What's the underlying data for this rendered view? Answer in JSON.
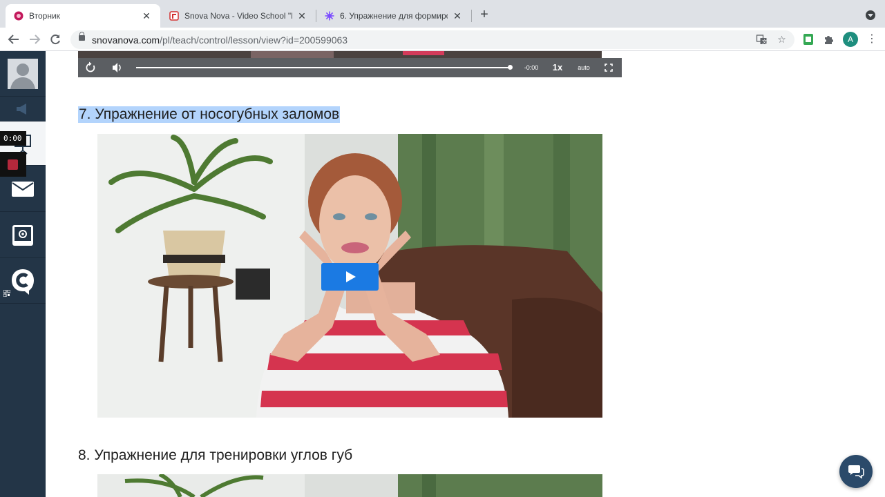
{
  "browser": {
    "tabs": [
      {
        "title": "Вторник",
        "active": true,
        "favicon_color": "#c2185b"
      },
      {
        "title": "Snova Nova - Video School \"El",
        "active": false,
        "favicon_color": "#d32f2f"
      },
      {
        "title": "6. Упражнение для формиров",
        "active": false,
        "favicon_color": "#7c4dff"
      }
    ],
    "new_tab_label": "+",
    "url_host": "snovanova.com",
    "url_path": "/pl/teach/control/lesson/view?id=200599063",
    "profile_initial": "A"
  },
  "sidebar": {
    "items": [
      {
        "name": "profile",
        "icon": "user-avatar-icon"
      },
      {
        "name": "announcements",
        "icon": "megaphone-icon"
      },
      {
        "name": "active-lesson",
        "icon": "presentation-icon"
      },
      {
        "name": "messages",
        "icon": "mail-icon"
      },
      {
        "name": "settings",
        "icon": "gear-monitor-icon"
      },
      {
        "name": "brand",
        "icon": "c-logo-icon"
      }
    ],
    "recorder_time": "0:00"
  },
  "player": {
    "time_remaining": "-0:00",
    "speed": "1x",
    "quality": "auto",
    "progress": 1.0
  },
  "sections": [
    {
      "heading": "7. Упражнение от носогубных заломов",
      "selected": true
    },
    {
      "heading": "8. Упражнение для тренировки углов губ",
      "selected": false
    }
  ],
  "colors": {
    "sidebar_bg": "#233547",
    "play_button": "#1b7ae3",
    "selection": "#b3d4fc",
    "chat_button": "#2b4a6a"
  }
}
